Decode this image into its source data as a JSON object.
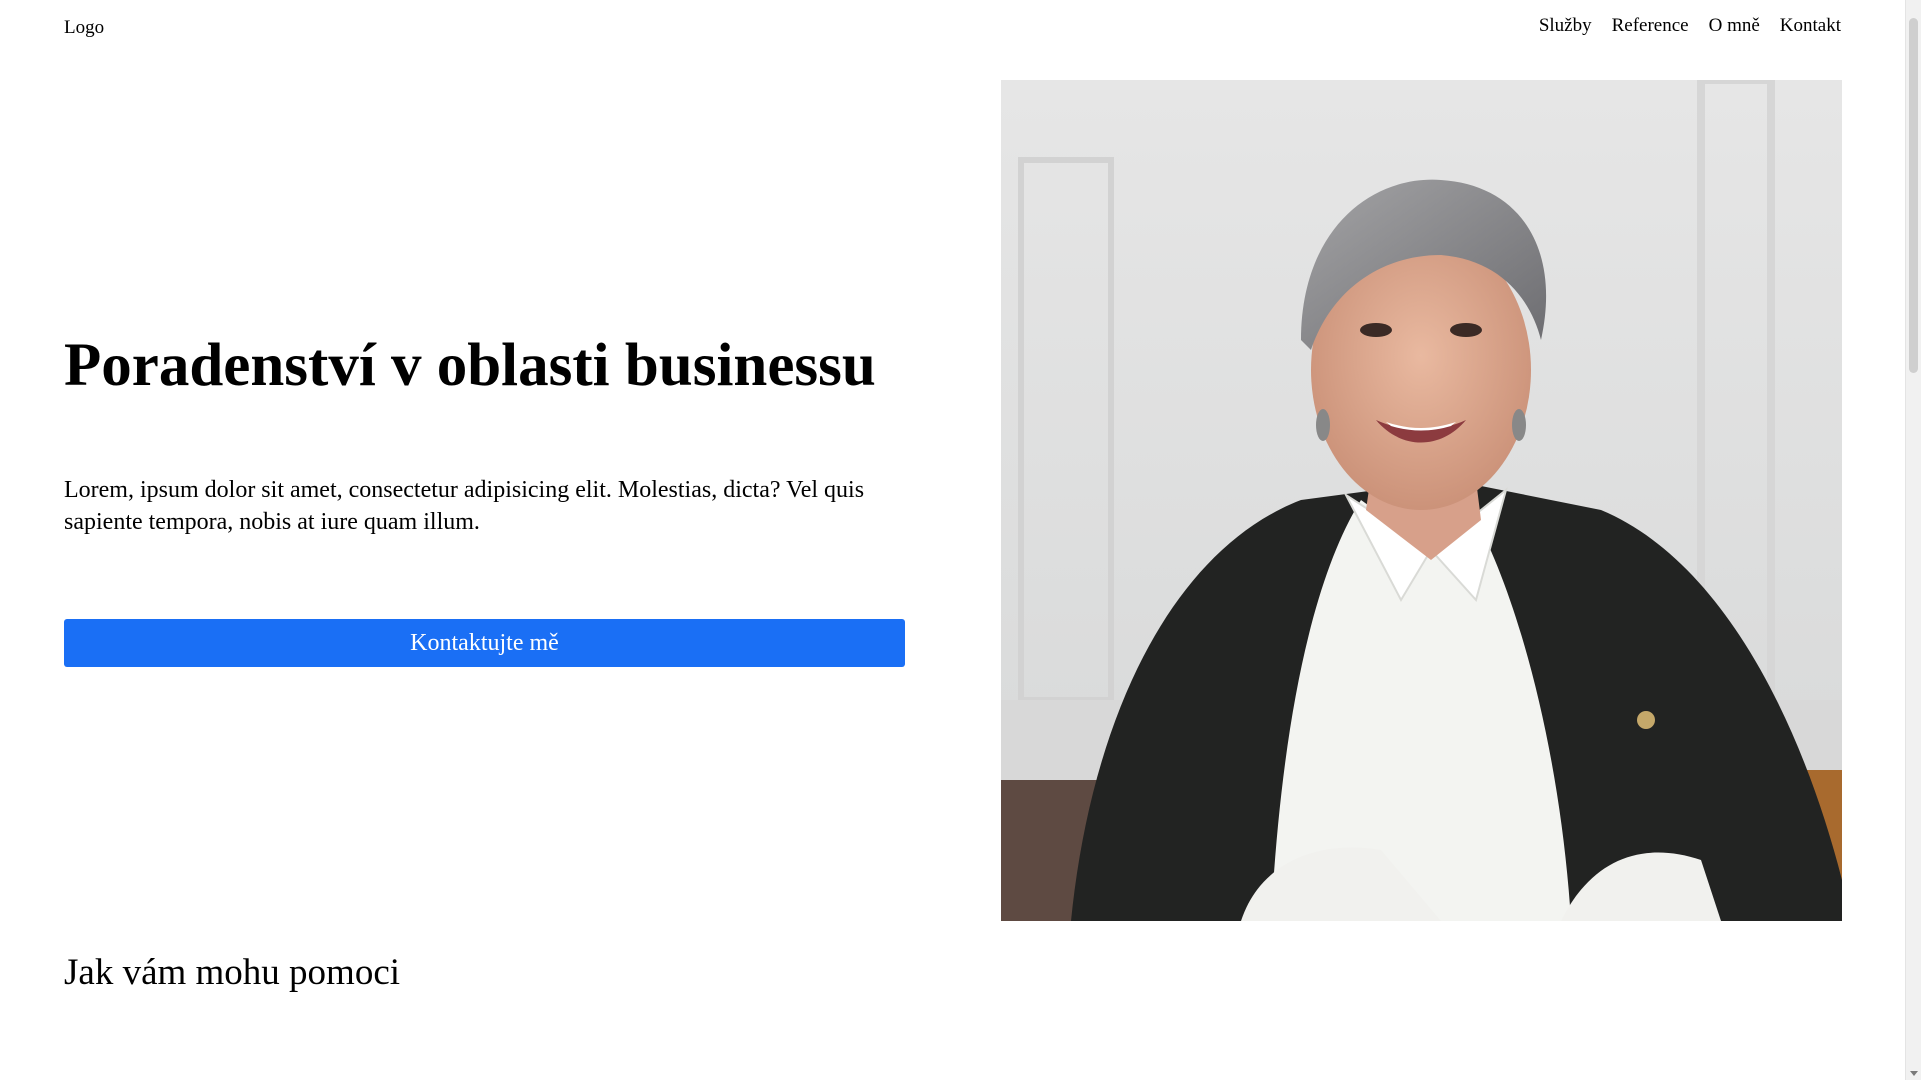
{
  "header": {
    "logo": "Logo",
    "nav": [
      {
        "label": "Služby"
      },
      {
        "label": "Reference"
      },
      {
        "label": "O mně"
      },
      {
        "label": "Kontakt"
      }
    ]
  },
  "hero": {
    "title": "Poradenství v oblasti businessu",
    "text": "Lorem, ipsum dolor sit amet, consectetur adipisicing elit. Molestias, dicta? Vel quis sapiente tempora, nobis at iure quam illum.",
    "button_label": "Kontaktujte mě",
    "image_subject": "portrait-of-smiling-consultant"
  },
  "services": {
    "title": "Jak vám mohu pomoci"
  },
  "colors": {
    "accent": "#1a6ff5",
    "text": "#000000",
    "background": "#ffffff"
  }
}
